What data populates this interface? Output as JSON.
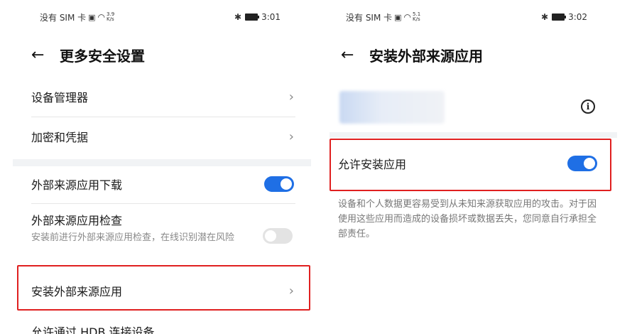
{
  "left": {
    "status": {
      "carrier": "没有 SIM 卡",
      "speed_top": "3.9",
      "speed_bottom": "K/s",
      "time": "3:01"
    },
    "header": {
      "back_icon": "arrow-left-icon",
      "title": "更多安全设置"
    },
    "items": {
      "device_admin": "设备管理器",
      "encryption": "加密和凭据",
      "external_download": "外部来源应用下载",
      "external_check": "外部来源应用检查",
      "external_check_desc": "安装前进行外部来源应用检查，在线识别潜在风险",
      "install_external": "安装外部来源应用",
      "usb_partial": "允许通过 HDB 连接设备"
    },
    "toggles": {
      "external_download": true,
      "external_check": false
    }
  },
  "right": {
    "status": {
      "carrier": "没有 SIM 卡",
      "speed_top": "5.1",
      "speed_bottom": "K/s",
      "time": "3:02"
    },
    "header": {
      "back_icon": "arrow-left-icon",
      "title": "安装外部来源应用"
    },
    "info_icon": "info-icon",
    "allow_install_label": "允许安装应用",
    "allow_install_enabled": true,
    "warning": "设备和个人数据更容易受到从未知来源获取应用的攻击。对于因使用这些应用而造成的设备损坏或数据丢失，您同意自行承担全部责任。"
  },
  "colors": {
    "accent": "#1f6fe5",
    "highlight": "#e02020"
  }
}
